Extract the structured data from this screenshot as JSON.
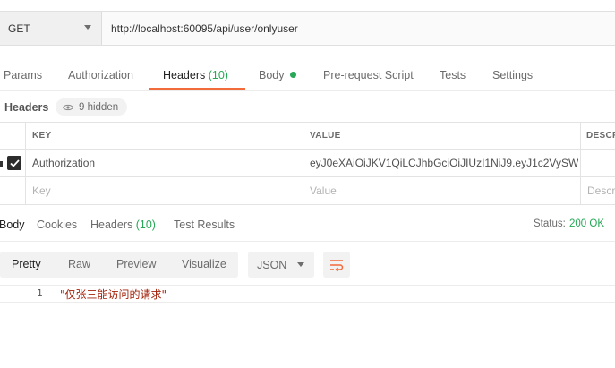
{
  "request": {
    "method": "GET",
    "url": "http://localhost:60095/api/user/onlyuser"
  },
  "request_tabs": [
    {
      "label": "Params",
      "count": "",
      "active": false
    },
    {
      "label": "Authorization",
      "count": "",
      "active": false
    },
    {
      "label": "Headers",
      "count": "(10)",
      "active": true
    },
    {
      "label": "Body",
      "count": "",
      "active": false,
      "dot": true
    },
    {
      "label": "Pre-request Script",
      "count": "",
      "active": false
    },
    {
      "label": "Tests",
      "count": "",
      "active": false
    },
    {
      "label": "Settings",
      "count": "",
      "active": false
    }
  ],
  "headers_section": {
    "title": "Headers",
    "hidden_label": "9 hidden"
  },
  "headers_table": {
    "columns": [
      "KEY",
      "VALUE",
      "DESCRI"
    ],
    "rows": [
      {
        "checked": true,
        "key": "Authorization",
        "value": "eyJ0eXAiOiJKV1QiLCJhbGciOiJIUzI1NiJ9.eyJ1c2VySW(..."
      }
    ],
    "placeholder": {
      "key": "Key",
      "value": "Value",
      "description": "Descr"
    }
  },
  "response_tabs": [
    {
      "label": "Body",
      "count": "",
      "active": true
    },
    {
      "label": "Cookies",
      "count": "",
      "active": false
    },
    {
      "label": "Headers",
      "count": "(10)",
      "active": false
    },
    {
      "label": "Test Results",
      "count": "",
      "active": false
    }
  ],
  "response_status": {
    "label": "Status:",
    "value": "200 OK"
  },
  "format_buttons": [
    {
      "label": "Pretty",
      "active": true
    },
    {
      "label": "Raw",
      "active": false
    },
    {
      "label": "Preview",
      "active": false
    },
    {
      "label": "Visualize",
      "active": false
    }
  ],
  "language_select": "JSON",
  "response_body": {
    "line_number": "1",
    "content": "\"仅张三能访问的请求\""
  },
  "colors": {
    "accent": "#f26b3a",
    "success": "#26a856",
    "string": "#a3210a"
  },
  "icons": {
    "method_dropdown": "chevron-down-icon",
    "hidden": "eye-icon",
    "checkbox": "checkbox-checked-icon",
    "wrap": "wrap-lines-icon"
  }
}
